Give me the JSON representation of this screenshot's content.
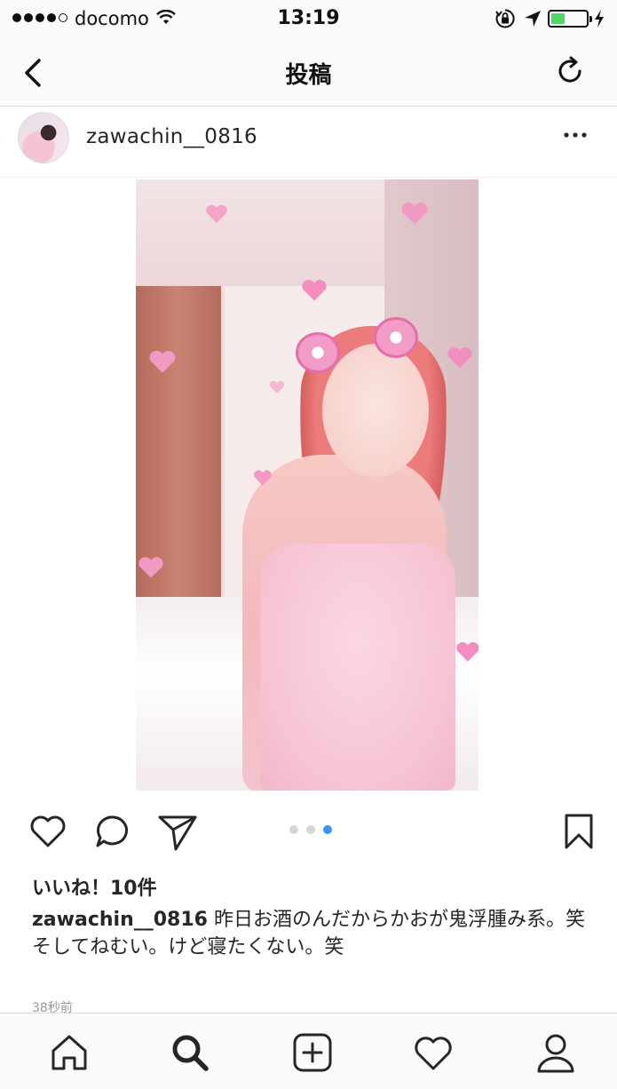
{
  "status_bar": {
    "carrier": "docomo",
    "time": "13:19",
    "signal_bars_filled": 4,
    "signal_bars_total": 5,
    "battery_level": 0.4,
    "battery_color": "#4cd964",
    "icons": [
      "wifi-icon",
      "rotation-lock-icon",
      "location-arrow-icon",
      "battery-icon",
      "charging-bolt-icon"
    ]
  },
  "nav": {
    "title": "投稿",
    "back_icon": "chevron-left-icon",
    "refresh_icon": "refresh-icon"
  },
  "post": {
    "username": "zawachin__0816",
    "more_icon": "ellipsis-icon",
    "carousel": {
      "count": 3,
      "active_index": 2
    },
    "likes": "いいね！10件",
    "caption_user": "zawachin__0816",
    "caption_text_line1": " 昨日お酒のんだからかおが鬼浮腫み系。笑",
    "caption_text_line2": "そしてねむい。けど寝たくない。笑",
    "timestamp": "38秒前"
  },
  "actions": [
    "heart-icon",
    "comment-icon",
    "share-icon",
    "bookmark-icon"
  ],
  "tab_bar": [
    "home-icon",
    "search-icon",
    "add-post-icon",
    "activity-heart-icon",
    "profile-icon"
  ],
  "colors": {
    "accent": "#3897f0",
    "text": "#262626",
    "muted": "#999999"
  }
}
